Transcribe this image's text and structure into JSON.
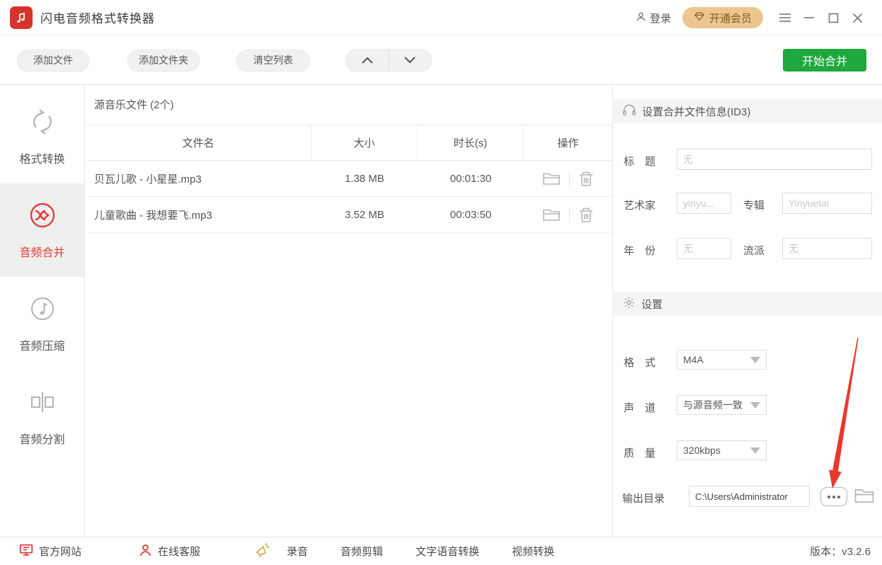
{
  "titlebar": {
    "app_title": "闪电音频格式转换器",
    "login_label": "登录",
    "vip_label": "开通会员"
  },
  "toolbar": {
    "add_file_label": "添加文件",
    "add_folder_label": "添加文件夹",
    "clear_list_label": "清空列表",
    "start_merge_label": "开始合并"
  },
  "sidebar": {
    "items": [
      {
        "label": "格式转换",
        "icon": "convert-icon",
        "active": false
      },
      {
        "label": "音频合并",
        "icon": "merge-icon",
        "active": true
      },
      {
        "label": "音频压缩",
        "icon": "compress-icon",
        "active": false
      },
      {
        "label": "音频分割",
        "icon": "split-icon",
        "active": false
      }
    ]
  },
  "file_list": {
    "title": "源音乐文件 (2个)",
    "columns": [
      "文件名",
      "大小",
      "时长(s)",
      "操作"
    ],
    "rows": [
      {
        "name": "贝瓦儿歌 - 小星星.mp3",
        "size": "1.38 MB",
        "duration": "00:01:30"
      },
      {
        "name": "儿童歌曲 - 我想要飞.mp3",
        "size": "3.52 MB",
        "duration": "00:03:50"
      }
    ]
  },
  "id3_panel": {
    "title": "设置合并文件信息(ID3)",
    "title_label": "标　题",
    "title_placeholder": "无",
    "artist_label": "艺术家",
    "artist_placeholder": "yinyu...",
    "album_label": "专辑",
    "album_placeholder": "Yinyuetai",
    "year_label": "年　份",
    "year_placeholder": "无",
    "genre_label": "流派",
    "genre_placeholder": "无"
  },
  "settings_panel": {
    "title": "设置",
    "format_label": "格　式",
    "format_value": "M4A",
    "channel_label": "声　道",
    "channel_value": "与源音频一致",
    "quality_label": "质　量",
    "quality_value": "320kbps",
    "output_label": "输出目录",
    "output_value": "C:\\Users\\Administrator"
  },
  "footer": {
    "links": [
      {
        "label": "官方网站"
      },
      {
        "label": "在线客服"
      },
      {
        "label": "录音"
      },
      {
        "label": "音频剪辑"
      },
      {
        "label": "文字语音转换"
      },
      {
        "label": "视频转换"
      }
    ],
    "version": "版本：v3.2.6"
  },
  "colors": {
    "accent_red": "#e03c3c",
    "brand_red": "#d5352c",
    "green": "#1fa83d",
    "vip_gold_bg": "#ecc68e",
    "vip_gold_text": "#7d5a1e"
  }
}
